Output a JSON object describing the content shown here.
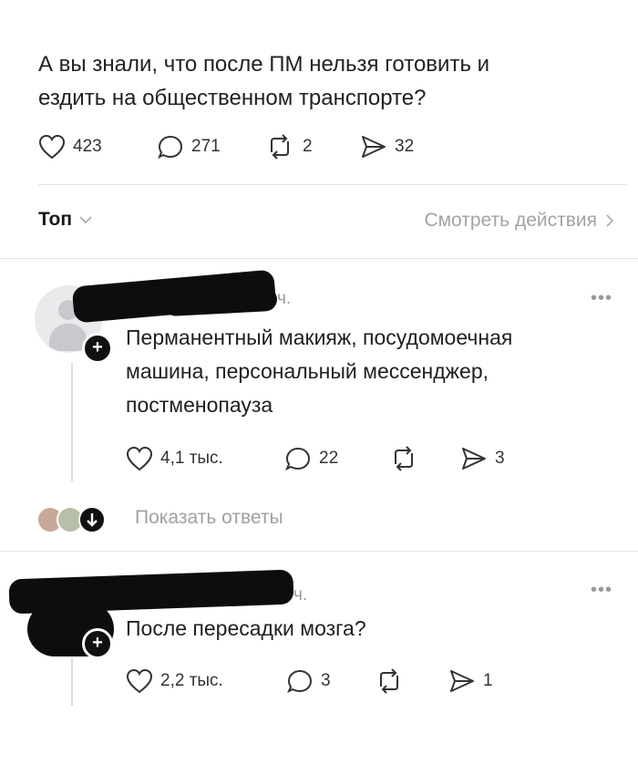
{
  "post": {
    "text_line1": "А вы знали, что после ПМ нельзя готовить и",
    "text_line2": "ездить на общественном транспорте?",
    "likes": "423",
    "replies": "271",
    "reposts": "2",
    "shares": "32"
  },
  "filter": {
    "sort_label": "Топ",
    "view_activity": "Смотреть действия"
  },
  "comments": [
    {
      "time_suffix": "ч.",
      "text_line1": "Перманентный макияж, посудомоечная",
      "text_line2": "машина, персональный мессенджер,",
      "text_line3": "постменопауза",
      "likes": "4,1 тыс.",
      "replies": "22",
      "shares": "3",
      "show_replies": "Показать ответы"
    },
    {
      "time_suffix": "ч.",
      "text_line1": "После пересадки мозга?",
      "likes": "2,2 тыс.",
      "replies": "3",
      "shares": "1"
    }
  ],
  "icons": {
    "like": "heart-icon",
    "reply": "speech-bubble-icon",
    "repost": "repost-icon",
    "share": "paper-plane-icon",
    "more": "more-dots-icon"
  }
}
